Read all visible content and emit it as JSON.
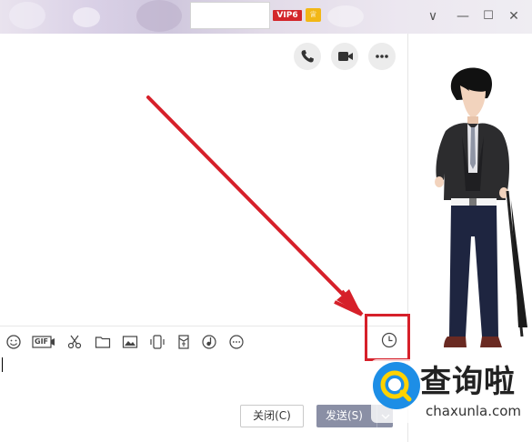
{
  "titlebar": {
    "vip_label": "VIP6",
    "crown_symbol": "♕",
    "minimize_symbol": "—",
    "restore_symbol": "☐",
    "close_symbol": "✕",
    "collapse_symbol": "∨"
  },
  "actions": {
    "icons": [
      "phone-icon",
      "video-icon",
      "more-icon"
    ]
  },
  "toolbar": {
    "icons": [
      "emoji-icon",
      "gif-icon",
      "scissors-icon",
      "folder-icon",
      "image-icon",
      "shake-icon",
      "red-packet-icon",
      "music-icon",
      "more-tools-icon",
      "history-icon"
    ],
    "gif_label": "GIF"
  },
  "buttons": {
    "close_label": "关闭(C)",
    "send_label": "发送(S)"
  },
  "watermark": {
    "text": "查询啦",
    "url": "chaxunla.com"
  },
  "colors": {
    "annotation_red": "#d6202a",
    "send_bg": "#8a8fa5",
    "watermark_blue": "#1d8ee6"
  }
}
